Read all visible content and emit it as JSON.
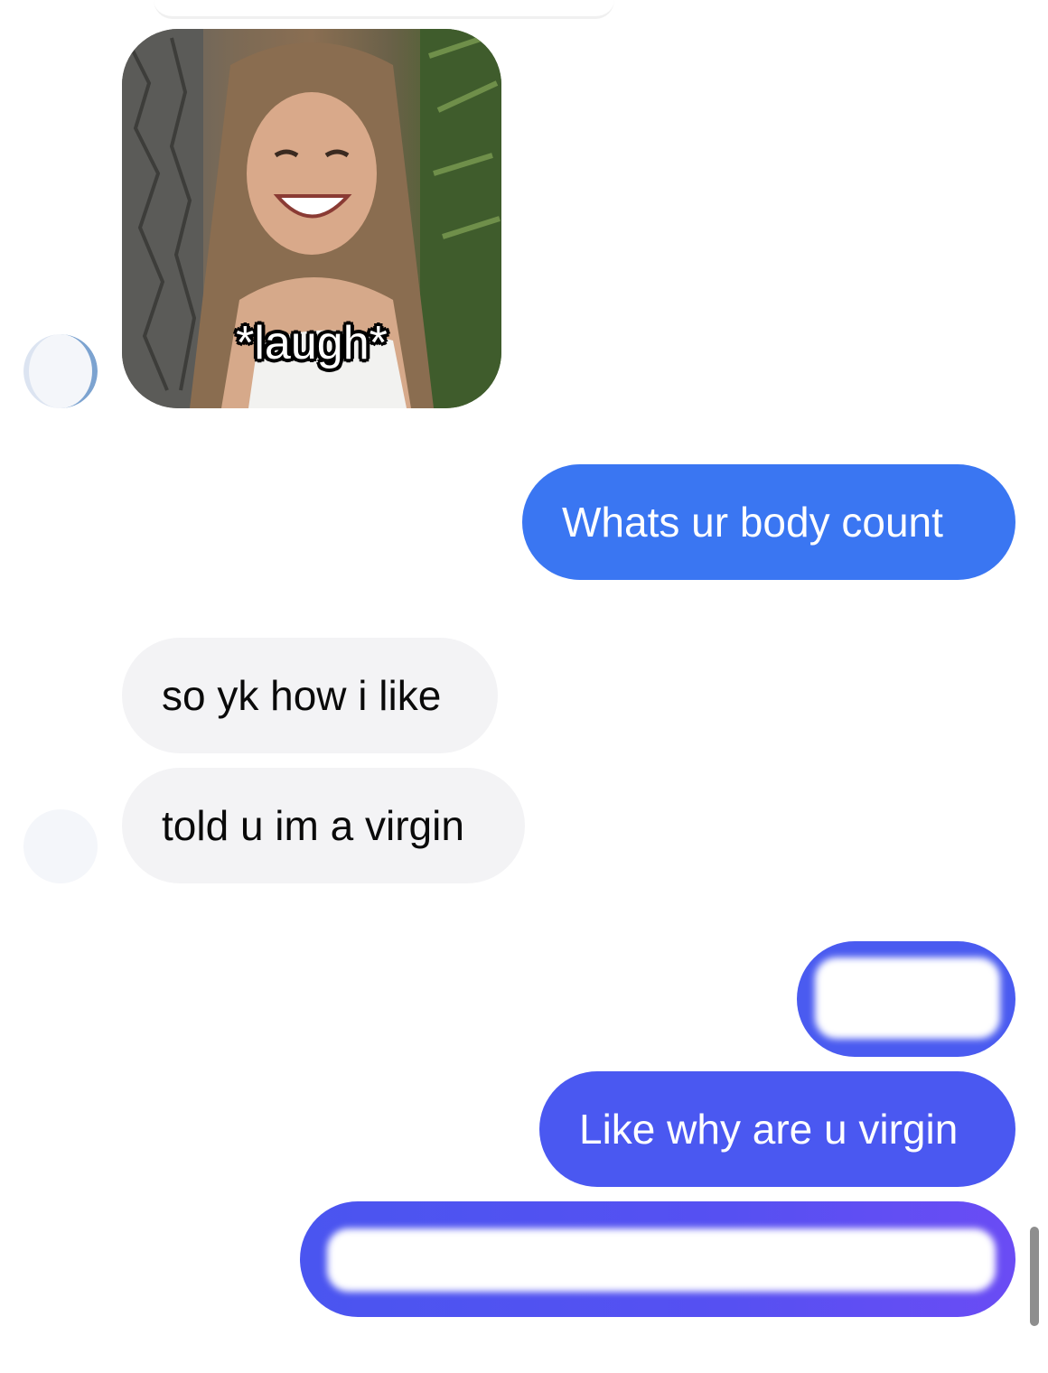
{
  "sticker": {
    "caption": "*laugh*"
  },
  "messages": [
    {
      "id": "out-1",
      "direction": "outgoing",
      "text": "Whats ur body count"
    },
    {
      "id": "in-1",
      "direction": "incoming",
      "text": "so yk how i like"
    },
    {
      "id": "in-2",
      "direction": "incoming",
      "text": "told u im a virgin"
    },
    {
      "id": "out-2",
      "direction": "outgoing",
      "text": "",
      "redacted": true
    },
    {
      "id": "out-3",
      "direction": "outgoing",
      "text": "Like why are u virgin"
    },
    {
      "id": "out-4",
      "direction": "outgoing",
      "text": "",
      "redacted": true
    }
  ],
  "colors": {
    "outgoing_bubble": "#3f6ff0",
    "incoming_bubble": "#f3f3f5",
    "background": "#ffffff"
  }
}
